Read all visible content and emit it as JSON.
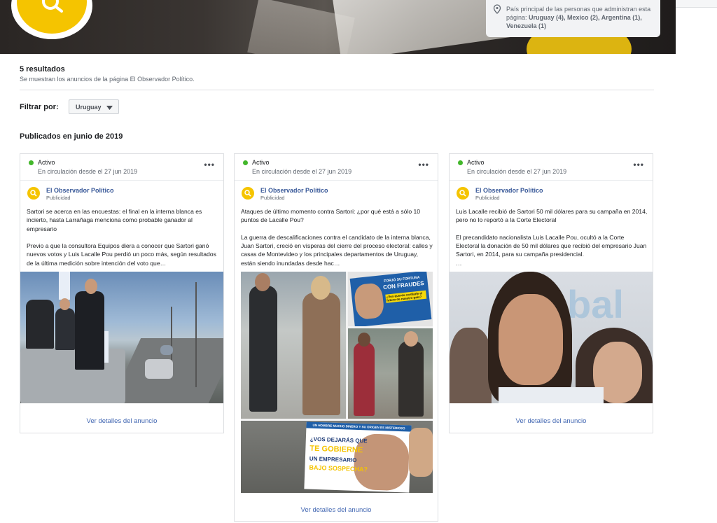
{
  "banner": {
    "countries_text_plain": "País principal de las personas que administran esta página: ",
    "countries_bold": "Uruguay (4), Mexico (2), Argentina (1), Venezuela (1)"
  },
  "results": {
    "count": "5 resultados",
    "subtitle": "Se muestran los anuncios de la página El Observador Político."
  },
  "filter": {
    "label": "Filtrar por:",
    "selected": "Uruguay"
  },
  "section_title": "Publicados en junio de 2019",
  "cards": [
    {
      "status": "Activo",
      "since": "En circulación desde el 27 jun 2019",
      "page_name": "El Observador Político",
      "page_sub": "Publicidad",
      "body": "Sartori se acerca en las encuestas: el final en la interna blanca es incierto, hasta Larrañaga menciona como probable ganador al empresario\n\nPrevio a que la consultora Equipos diera a conocer que Sartori ganó nuevos votos y Luis Lacalle Pou perdió un poco más, según resultados de la última medición sobre intención del voto que…",
      "cta": "Ver detalles del anuncio"
    },
    {
      "status": "Activo",
      "since": "En circulación desde el 27 jun 2019",
      "page_name": "El Observador Político",
      "page_sub": "Publicidad",
      "body": "Ataques de último momento contra Sartori: ¿por qué está a sólo 10 puntos de Lacalle Pou?\n\nLa guerra de descalificaciones contra el candidato de la interna blanca, Juan Sartori, creció en vísperas del cierre del proceso electoral: calles y casas de Montevideo y los principales departamentos de Uruguay, están siendo inundadas desde hac…",
      "cta": "Ver detalles del anuncio",
      "flyer_top": [
        "FORJÓ SU FORTUNA",
        "CON FRAUDES"
      ],
      "flyer_top_small": "¿Vos querés confiarle el futuro de nuestro país?",
      "flyer_bottom_head": "UN HOMBRE MUCHO DINERO Y SU ORIGEN ES MISTERIOSO",
      "flyer_bottom": [
        "¿VOS DEJARÁS QUE",
        "TE GOBIERNE",
        "UN EMPRESARIO",
        "BAJO SOSPECHA?"
      ]
    },
    {
      "status": "Activo",
      "since": "En circulación desde el 27 jun 2019",
      "page_name": "El Observador Político",
      "page_sub": "Publicidad",
      "body": "Luis Lacalle recibió de Sartori 50 mil dólares para su campaña en 2014, pero no lo reportó a la Corte Electoral\n\nEl precandidato nacionalista Luis Lacalle Pou, ocultó a la Corte Electoral la donación de 50 mil dólares que recibió del empresario Juan Sartori, en 2014, para su campaña presidencial.\n…",
      "cta": "Ver detalles del anuncio",
      "bg_word": "bal"
    }
  ],
  "colors": {
    "status_active": "#42b72a",
    "link": "#4267b2",
    "page_name": "#385898",
    "brand_yellow": "#f5c400"
  },
  "icons": {
    "avatar": "speech-bubble-search-icon",
    "location": "location-pin-icon",
    "more": "more-options-icon",
    "caret": "caret-down-icon"
  }
}
